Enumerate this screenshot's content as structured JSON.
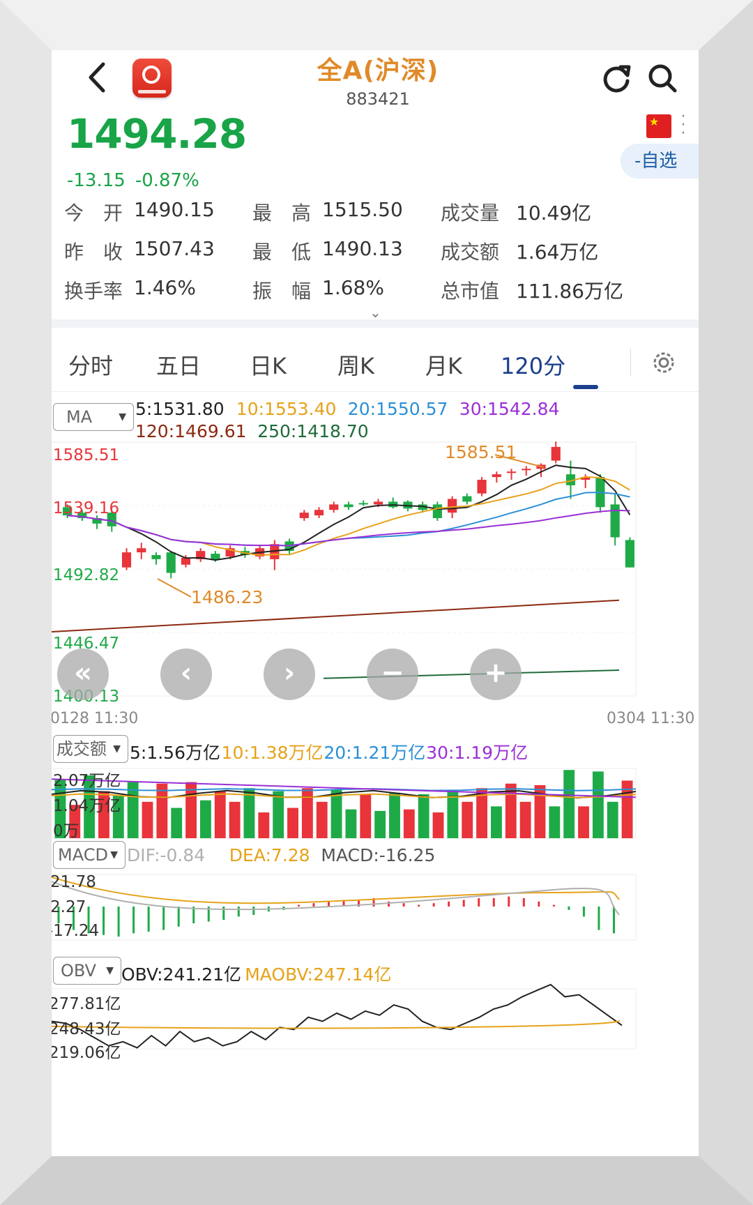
{
  "header": {
    "title": "全A(沪深)",
    "code": "883421"
  },
  "quote": {
    "price": "1494.28",
    "change": "-13.15",
    "change_pct": "-0.87%",
    "watch_label": "-自选"
  },
  "stats": [
    {
      "label": "今　开",
      "value": "1490.15"
    },
    {
      "label": "最　高",
      "value": "1515.50"
    },
    {
      "label": "成交量",
      "value": "10.49亿"
    },
    {
      "label": "昨　收",
      "value": "1507.43"
    },
    {
      "label": "最　低",
      "value": "1490.13"
    },
    {
      "label": "成交额",
      "value": "1.64万亿"
    },
    {
      "label": "换手率",
      "value": "1.46%"
    },
    {
      "label": "振　幅",
      "value": "1.68%"
    },
    {
      "label": "总市值",
      "value": "111.86万亿"
    }
  ],
  "tabs": [
    "分时",
    "五日",
    "日K",
    "周K",
    "月K",
    "120分"
  ],
  "active_tab": "120分",
  "main_chart": {
    "selector": "MA",
    "ma": [
      {
        "text": "5:1531.80",
        "color": "#222222"
      },
      {
        "text": "10:1553.40",
        "color": "#e6a21a"
      },
      {
        "text": "20:1550.57",
        "color": "#2b8fd6"
      },
      {
        "text": "30:1542.84",
        "color": "#9b2fd6"
      },
      {
        "text": "120:1469.61",
        "color": "#8b2a10"
      },
      {
        "text": "250:1418.70",
        "color": "#1f6b3a"
      }
    ],
    "y_ticks": [
      "1585.51",
      "1539.16",
      "1492.82",
      "1446.47",
      "1400.13"
    ],
    "high_label": "1585.51",
    "low_label": "1486.23",
    "start_time": "0128 11:30",
    "end_time": "0304 11:30"
  },
  "chart_data": {
    "type": "candlestick",
    "ylim": [
      1400.13,
      1585.51
    ],
    "candles": [
      [
        1538,
        1540,
        1530,
        1532
      ],
      [
        1534,
        1536,
        1528,
        1530
      ],
      [
        1530,
        1532,
        1522,
        1526
      ],
      [
        1534,
        1536,
        1520,
        1524
      ],
      [
        1494,
        1508,
        1492,
        1505
      ],
      [
        1505,
        1512,
        1500,
        1508
      ],
      [
        1503,
        1505,
        1496,
        1500
      ],
      [
        1505,
        1506,
        1486,
        1490
      ],
      [
        1496,
        1503,
        1494,
        1501
      ],
      [
        1500,
        1508,
        1498,
        1506
      ],
      [
        1504,
        1506,
        1498,
        1500
      ],
      [
        1502,
        1510,
        1500,
        1508
      ],
      [
        1506,
        1509,
        1501,
        1503
      ],
      [
        1502,
        1510,
        1500,
        1508
      ],
      [
        1500,
        1514,
        1492,
        1511
      ],
      [
        1513,
        1515,
        1503,
        1506
      ],
      [
        1530,
        1536,
        1528,
        1534
      ],
      [
        1532,
        1538,
        1530,
        1536
      ],
      [
        1536,
        1542,
        1534,
        1540
      ],
      [
        1540,
        1542,
        1536,
        1538
      ],
      [
        1541,
        1543,
        1539,
        1540
      ],
      [
        1540,
        1544,
        1538,
        1542
      ],
      [
        1542,
        1545,
        1537,
        1538
      ],
      [
        1542,
        1543,
        1535,
        1537
      ],
      [
        1540,
        1542,
        1534,
        1536
      ],
      [
        1540,
        1542,
        1528,
        1530
      ],
      [
        1534,
        1546,
        1530,
        1544
      ],
      [
        1546,
        1548,
        1540,
        1542
      ],
      [
        1548,
        1560,
        1546,
        1558
      ],
      [
        1560,
        1564,
        1556,
        1562
      ],
      [
        1563,
        1566,
        1558,
        1564
      ],
      [
        1565,
        1568,
        1561,
        1566
      ],
      [
        1566,
        1570,
        1560,
        1569
      ],
      [
        1572,
        1586,
        1570,
        1582
      ],
      [
        1562,
        1572,
        1544,
        1554
      ],
      [
        1558,
        1562,
        1552,
        1560
      ],
      [
        1560,
        1562,
        1534,
        1538
      ],
      [
        1540,
        1548,
        1510,
        1516
      ],
      [
        1514,
        1516,
        1494,
        1494
      ]
    ],
    "volume_ylim": [
      0,
      2.07
    ],
    "volume_ticks": [
      "2.07万亿",
      "1.04万亿",
      "0万"
    ],
    "volume": [
      1.95,
      1.1,
      2.07,
      1.55,
      1.4,
      1.85,
      1.2,
      1.8,
      1.0,
      1.85,
      1.25,
      1.55,
      1.2,
      1.65,
      0.85,
      1.55,
      1.0,
      1.65,
      1.2,
      1.6,
      0.95,
      1.45,
      0.9,
      1.5,
      0.95,
      1.45,
      0.85,
      1.6,
      1.2,
      1.65,
      1.05,
      1.8,
      1.2,
      1.75,
      1.05,
      2.25,
      1.05,
      2.2,
      1.2,
      1.9
    ],
    "volume_dir": [
      "g",
      "r",
      "g",
      "r",
      "g",
      "g",
      "r",
      "r",
      "g",
      "r",
      "g",
      "r",
      "r",
      "g",
      "r",
      "g",
      "r",
      "r",
      "r",
      "g",
      "g",
      "r",
      "g",
      "g",
      "r",
      "g",
      "r",
      "g",
      "r",
      "r",
      "g",
      "r",
      "r",
      "r",
      "g",
      "g",
      "r",
      "g",
      "g",
      "r"
    ]
  },
  "volume_panel": {
    "selector": "成交额",
    "legend": [
      {
        "text": "5:1.56万亿",
        "color": "#222222"
      },
      {
        "text": "10:1.38万亿",
        "color": "#e6a21a"
      },
      {
        "text": "20:1.21万亿",
        "color": "#2b8fd6"
      },
      {
        "text": "30:1.19万亿",
        "color": "#9b2fd6"
      }
    ]
  },
  "macd_panel": {
    "selector": "MACD",
    "legend": [
      {
        "text": "DIF:-0.84",
        "color": "#b0b0b0"
      },
      {
        "text": "DEA:7.28",
        "color": "#e6a21a"
      },
      {
        "text": "MACD:-16.25",
        "color": "#555555"
      }
    ],
    "y_ticks": [
      "21.78",
      "2.27",
      "-17.24"
    ]
  },
  "obv_panel": {
    "selector": "OBV",
    "legend": [
      {
        "text": "OBV:241.21亿",
        "color": "#222222"
      },
      {
        "text": "MAOBV:247.14亿",
        "color": "#e6a21a"
      }
    ],
    "y_ticks": [
      "277.81亿",
      "248.43亿",
      "219.06亿"
    ]
  },
  "colors": {
    "up": "#e8343a",
    "down": "#1faa48",
    "accent": "#1c3f8c",
    "title": "#e08a28"
  },
  "icons": [
    "back-arrow-icon",
    "app-logo-icon",
    "refresh-icon",
    "search-icon",
    "china-flag-icon",
    "more-icon",
    "gear-icon"
  ]
}
